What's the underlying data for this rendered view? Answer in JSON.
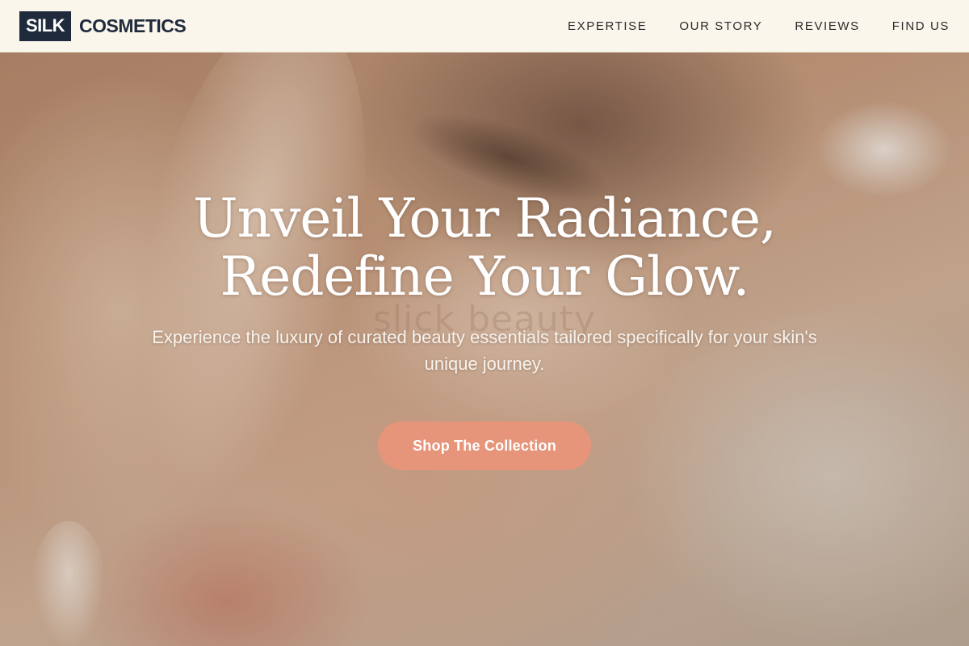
{
  "brand": {
    "box_text": "SILK",
    "name": "COSMETICS"
  },
  "nav": {
    "items": [
      {
        "label": "EXPERTISE"
      },
      {
        "label": "OUR STORY"
      },
      {
        "label": "REVIEWS"
      },
      {
        "label": "FIND US"
      }
    ]
  },
  "hero": {
    "headline_line1": "Unveil Your Radiance,",
    "headline_line2": "Redefine Your Glow.",
    "watermark": "slick beauty",
    "subtitle": "Experience the luxury of curated beauty essentials tailored specifically for your skin's unique journey.",
    "cta_label": "Shop The Collection"
  },
  "colors": {
    "brand_navy": "#1f2a3d",
    "header_bg": "#fbf6ec",
    "cta_bg": "#e6957b"
  }
}
